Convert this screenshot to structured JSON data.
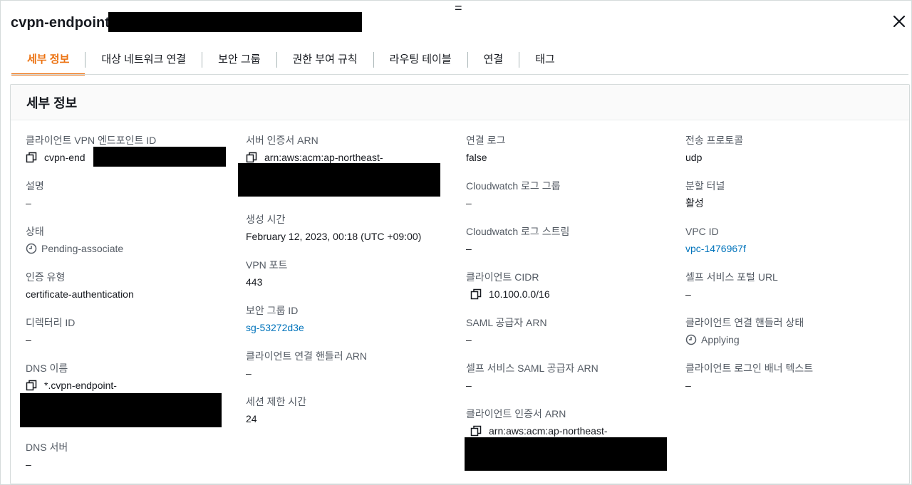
{
  "title": "cvpn-endpoint-",
  "tabs": [
    {
      "label": "세부 정보",
      "active": true
    },
    {
      "label": "대상 네트워크 연결",
      "active": false
    },
    {
      "label": "보안 그룹",
      "active": false
    },
    {
      "label": "권한 부여 규칙",
      "active": false
    },
    {
      "label": "라우팅 테이블",
      "active": false
    },
    {
      "label": "연결",
      "active": false
    },
    {
      "label": "태그",
      "active": false
    }
  ],
  "panel": {
    "title": "세부 정보"
  },
  "col1": {
    "endpoint_id": {
      "label": "클라이언트 VPN 엔드포인트 ID",
      "value": "cvpn-end"
    },
    "description": {
      "label": "설명",
      "value": "–"
    },
    "state": {
      "label": "상태",
      "value": "Pending-associate"
    },
    "auth_type": {
      "label": "인증 유형",
      "value": "certificate-authentication"
    },
    "directory_id": {
      "label": "디렉터리 ID",
      "value": "–"
    },
    "dns_name": {
      "label": "DNS 이름",
      "value": "*.cvpn-endpoint-"
    },
    "dns_server": {
      "label": "DNS 서버",
      "value": "–"
    }
  },
  "col2": {
    "server_cert_arn": {
      "label": "서버 인증서 ARN",
      "value": "arn:aws:acm:ap-northeast-"
    },
    "created": {
      "label": "생성 시간",
      "value": "February 12, 2023, 00:18 (UTC +09:00)"
    },
    "vpn_port": {
      "label": "VPN 포트",
      "value": "443"
    },
    "security_group": {
      "label": "보안 그룹 ID",
      "value": "sg-53272d3e"
    },
    "handler_arn": {
      "label": "클라이언트 연결 핸들러 ARN",
      "value": "–"
    },
    "session_timeout": {
      "label": "세션 제한 시간",
      "value": "24"
    }
  },
  "col3": {
    "conn_log": {
      "label": "연결 로그",
      "value": "false"
    },
    "cw_group": {
      "label": "Cloudwatch 로그 그룹",
      "value": "–"
    },
    "cw_stream": {
      "label": "Cloudwatch 로그 스트림",
      "value": "–"
    },
    "client_cidr": {
      "label": "클라이언트 CIDR",
      "value": "10.100.0.0/16"
    },
    "saml_arn": {
      "label": "SAML 공급자 ARN",
      "value": "–"
    },
    "self_saml_arn": {
      "label": "셀프 서비스 SAML 공급자 ARN",
      "value": "–"
    },
    "client_cert_arn": {
      "label": "클라이언트 인증서 ARN",
      "value": "arn:aws:acm:ap-northeast-"
    }
  },
  "col4": {
    "protocol": {
      "label": "전송 프로토콜",
      "value": "udp"
    },
    "split_tunnel": {
      "label": "분할 터널",
      "value": "활성"
    },
    "vpc_id": {
      "label": "VPC ID",
      "value": "vpc-1476967f"
    },
    "portal_url": {
      "label": "셀프 서비스 포털 URL",
      "value": "–"
    },
    "handler_state": {
      "label": "클라이언트 연결 핸들러 상태",
      "value": "Applying"
    },
    "banner_text": {
      "label": "클라이언트 로그인 배너 텍스트",
      "value": "–"
    }
  },
  "icons": {
    "copy": "copy-icon",
    "clock": "clock-icon",
    "close": "close-icon",
    "drag": "drag-handle-icon"
  },
  "colors": {
    "accent": "#ec7211",
    "link": "#0073bb",
    "border": "#d5dbdb"
  }
}
